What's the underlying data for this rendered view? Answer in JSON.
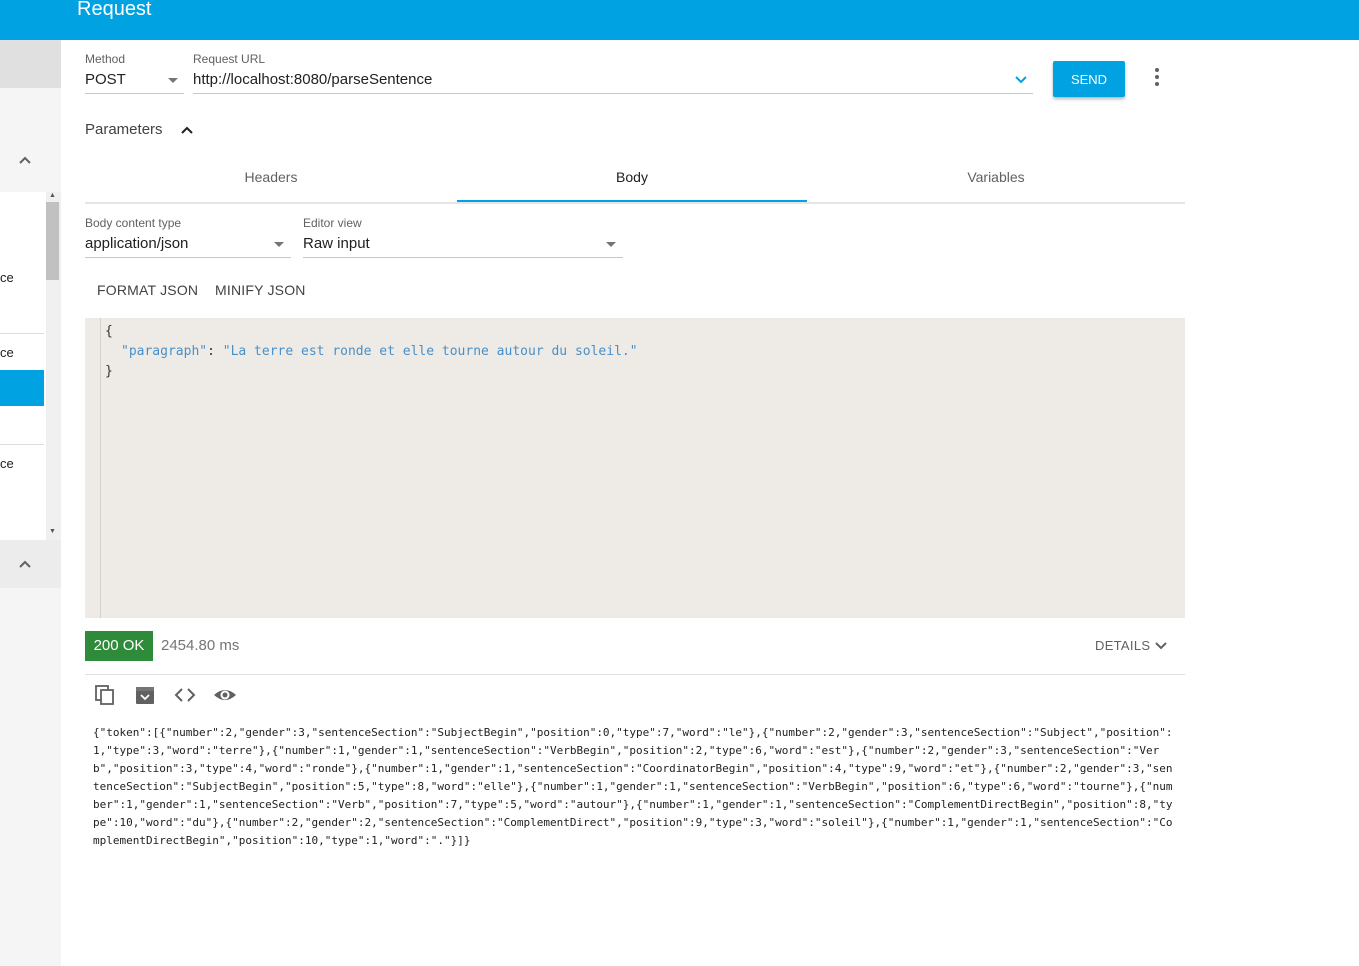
{
  "app": {
    "title": "Request"
  },
  "sidebar": {
    "items": [
      {
        "label": "ce"
      },
      {
        "label": "ce"
      },
      {
        "label": "ce"
      }
    ]
  },
  "request": {
    "method_label": "Method",
    "method_value": "POST",
    "url_label": "Request URL",
    "url_value": "http://localhost:8080/parseSentence",
    "send_label": "SEND"
  },
  "parameters": {
    "label": "Parameters"
  },
  "tabs": [
    {
      "label": "Headers",
      "active": false
    },
    {
      "label": "Body",
      "active": true
    },
    {
      "label": "Variables",
      "active": false
    }
  ],
  "body": {
    "content_type_label": "Body content type",
    "content_type_value": "application/json",
    "editor_view_label": "Editor view",
    "editor_view_value": "Raw input",
    "format_label": "FORMAT JSON",
    "minify_label": "MINIFY JSON"
  },
  "editor": {
    "open_brace": "{",
    "key": "\"paragraph\"",
    "colon": ": ",
    "value": "\"La terre est ronde et elle tourne autour du soleil.\"",
    "close_brace": "}"
  },
  "response": {
    "status": "200 OK",
    "time": "2454.80 ms",
    "details_label": "DETAILS",
    "body": "{\"token\":[{\"number\":2,\"gender\":3,\"sentenceSection\":\"SubjectBegin\",\"position\":0,\"type\":7,\"word\":\"le\"},{\"number\":2,\"gender\":3,\"sentenceSection\":\"Subject\",\"position\":1,\"type\":3,\"word\":\"terre\"},{\"number\":1,\"gender\":1,\"sentenceSection\":\"VerbBegin\",\"position\":2,\"type\":6,\"word\":\"est\"},{\"number\":2,\"gender\":3,\"sentenceSection\":\"Verb\",\"position\":3,\"type\":4,\"word\":\"ronde\"},{\"number\":1,\"gender\":1,\"sentenceSection\":\"CoordinatorBegin\",\"position\":4,\"type\":9,\"word\":\"et\"},{\"number\":2,\"gender\":3,\"sentenceSection\":\"SubjectBegin\",\"position\":5,\"type\":8,\"word\":\"elle\"},{\"number\":1,\"gender\":1,\"sentenceSection\":\"VerbBegin\",\"position\":6,\"type\":6,\"word\":\"tourne\"},{\"number\":1,\"gender\":1,\"sentenceSection\":\"Verb\",\"position\":7,\"type\":5,\"word\":\"autour\"},{\"number\":1,\"gender\":1,\"sentenceSection\":\"ComplementDirectBegin\",\"position\":8,\"type\":10,\"word\":\"du\"},{\"number\":2,\"gender\":2,\"sentenceSection\":\"ComplementDirect\",\"position\":9,\"type\":3,\"word\":\"soleil\"},{\"number\":1,\"gender\":1,\"sentenceSection\":\"ComplementDirectBegin\",\"position\":10,\"type\":1,\"word\":\".\"}]}"
  },
  "colors": {
    "accent": "#00A2E2",
    "success": "#2E8B3A",
    "editor_bg": "#EEEAE6"
  },
  "icons": {
    "more": "more-vert-icon",
    "copy": "copy-icon",
    "save": "save-icon",
    "code": "code-icon",
    "preview": "eye-icon"
  }
}
